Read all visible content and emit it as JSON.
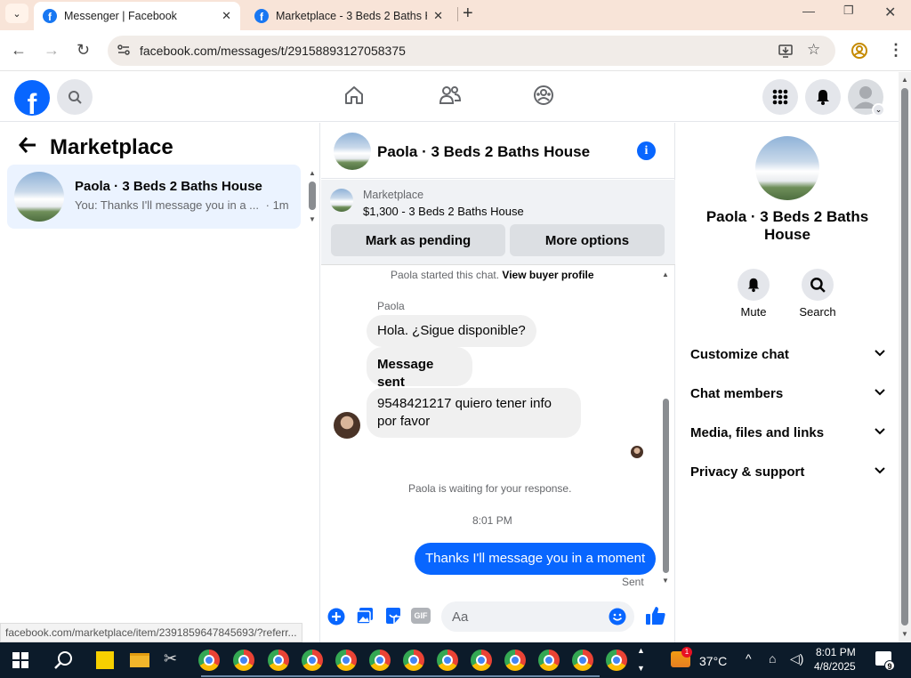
{
  "browser": {
    "tabs": [
      {
        "title": "Messenger | Facebook",
        "active": true
      },
      {
        "title": "Marketplace - 3 Beds 2 Baths H",
        "active": false
      }
    ],
    "url": "facebook.com/messages/t/29158893127058375",
    "status_url": "facebook.com/marketplace/item/2391859647845693/?referr..."
  },
  "left_panel": {
    "title": "Marketplace",
    "threads": [
      {
        "name": "Paola · 3 Beds 2 Baths House",
        "snippet": "You: Thanks I'll message you in a ...",
        "time": "· 1m"
      }
    ]
  },
  "chat": {
    "title": "Paola · 3 Beds 2 Baths House",
    "listing_label": "Marketplace",
    "listing_price": "$1,300 - 3 Beds 2 Baths House",
    "mark_pending": "Mark as pending",
    "more_options": "More options",
    "started_text": "Paola started this chat.",
    "view_profile": "View buyer profile",
    "sender_name": "Paola",
    "messages": [
      "Hola. ¿Sigue disponible?",
      "Message sent",
      "9548421217 quiero tener info por favor"
    ],
    "waiting": "Paola is waiting for your response.",
    "time": "8:01 PM",
    "outgoing": "Thanks I'll message you in a moment",
    "sent_status": "Sent",
    "composer_placeholder": "Aa"
  },
  "right_panel": {
    "name": "Paola · 3 Beds 2 Baths House",
    "mute": "Mute",
    "search": "Search",
    "sections": [
      "Customize chat",
      "Chat members",
      "Media, files and links",
      "Privacy & support"
    ]
  },
  "taskbar": {
    "temperature": "37°C",
    "time": "8:01 PM",
    "date": "4/8/2025",
    "notifications": "9",
    "badge": "1"
  },
  "colors": {
    "fb_blue": "#0866ff",
    "tabbar": "#f8e4d8",
    "taskbar": "#0c1b2a"
  }
}
